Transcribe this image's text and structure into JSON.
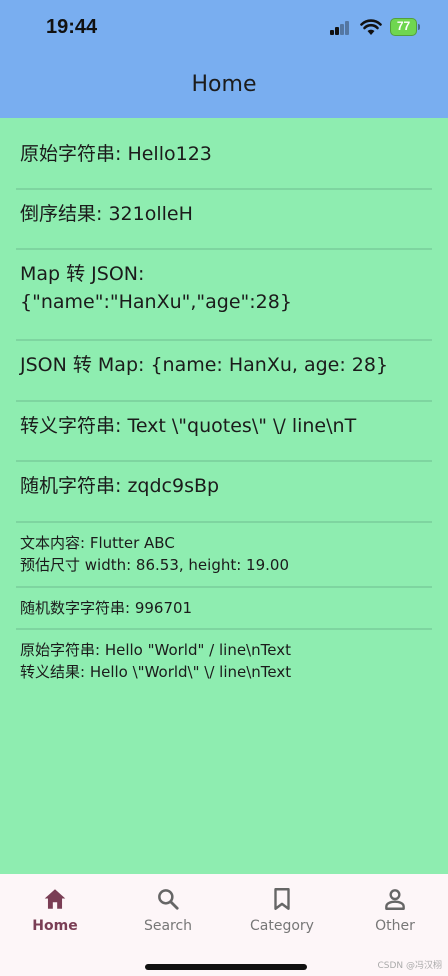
{
  "status": {
    "time": "19:44",
    "battery": "77"
  },
  "appbar": {
    "title": "Home"
  },
  "rows": [
    {
      "text": "原始字符串: Hello123"
    },
    {
      "text": "倒序结果: 321olleH"
    },
    {
      "line1": "Map 转 JSON:",
      "line2": "{\"name\":\"HanXu\",\"age\":28}"
    },
    {
      "text": "JSON 转 Map: {name: HanXu, age: 28}"
    },
    {
      "text": "转义字符串: Text \\\"quotes\\\" \\/ line\\nT"
    },
    {
      "text": "随机字符串: zqdc9sBp"
    },
    {
      "line1": "文本内容: Flutter ABC",
      "line2": "预估尺寸 width: 86.53, height: 19.00"
    },
    {
      "text": "随机数字字符串: 996701"
    },
    {
      "line1": "原始字符串: Hello \"World\" / line\\nText",
      "line2": "转义结果: Hello \\\"World\\\" \\/ line\\nText"
    }
  ],
  "nav": {
    "items": [
      {
        "label": "Home",
        "icon": "home-icon",
        "active": true
      },
      {
        "label": "Search",
        "icon": "search-icon",
        "active": false
      },
      {
        "label": "Category",
        "icon": "bookmark-icon",
        "active": false
      },
      {
        "label": "Other",
        "icon": "person-icon",
        "active": false
      }
    ]
  },
  "watermark": "CSDN @冯汉栩",
  "colors": {
    "appbar": "#79aef0",
    "background": "#8eedb0",
    "nav_active": "#7a3e55",
    "nav_inactive": "#777777"
  }
}
